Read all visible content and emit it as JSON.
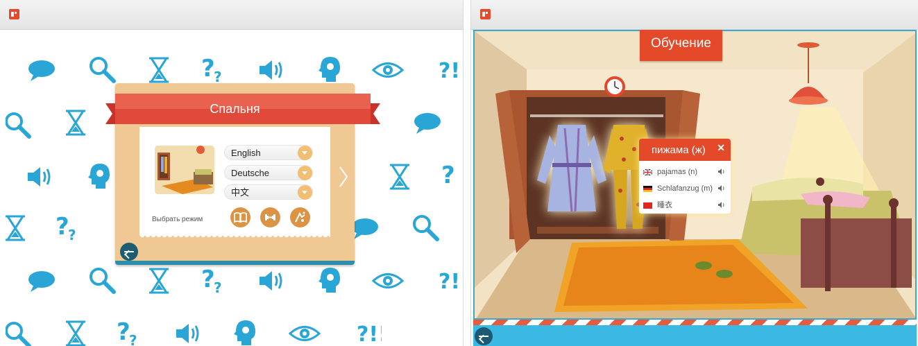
{
  "left_window": {
    "card_title": "Спальня",
    "languages": [
      {
        "label": "English"
      },
      {
        "label": "Deutsche"
      },
      {
        "label": "中文"
      }
    ],
    "mode_label": "Выбрать режим",
    "mode_buttons": [
      "book-mode",
      "exercise-mode",
      "game-mode"
    ],
    "icon_color": "#2aa6d6",
    "accent": "#e44a2a"
  },
  "right_window": {
    "scene_tag": "Обучение",
    "popup": {
      "word": "пижама (ж)",
      "close": "✕",
      "translations": [
        {
          "flag": "uk-flag-icon",
          "text": "pajamas (n)"
        },
        {
          "flag": "german-flag-icon",
          "text": "Schlafanzug (m)"
        },
        {
          "flag": "china-flag-icon",
          "text": "睡衣"
        }
      ]
    }
  }
}
